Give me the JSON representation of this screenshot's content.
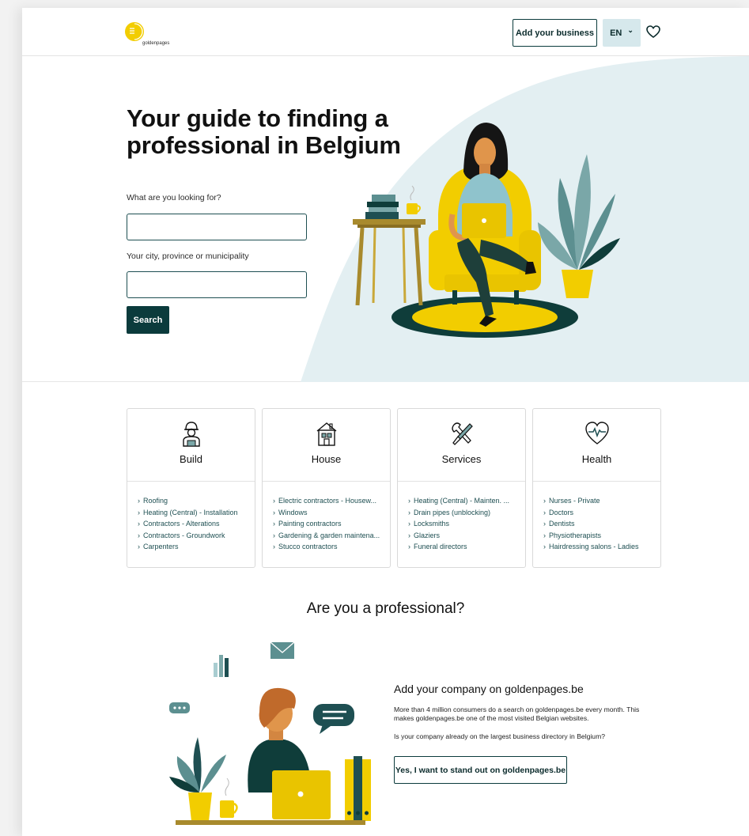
{
  "header": {
    "logo_text": "goldenpages",
    "add_business_label": "Add your business",
    "lang_label": "EN",
    "lang_chevron": "⌄"
  },
  "hero": {
    "title": "Your guide to finding a professional in Belgium",
    "what_label": "What are you looking for?",
    "what_value": "",
    "where_label": "Your city, province or municipality",
    "where_value": "",
    "search_label": "Search"
  },
  "categories": [
    {
      "title": "Build",
      "icon": "worker-icon",
      "items": [
        "Roofing",
        "Heating (Central) - Installation",
        "Contractors - Alterations",
        "Contractors - Groundwork",
        "Carpenters"
      ]
    },
    {
      "title": "House",
      "icon": "house-icon",
      "items": [
        "Electric contractors - Housew...",
        "Windows",
        "Painting contractors",
        "Gardening & garden maintena...",
        "Stucco contractors"
      ]
    },
    {
      "title": "Services",
      "icon": "tools-icon",
      "items": [
        "Heating (Central) - Mainten. ...",
        "Drain pipes (unblocking)",
        "Locksmiths",
        "Glaziers",
        "Funeral directors"
      ]
    },
    {
      "title": "Health",
      "icon": "heartbeat-icon",
      "items": [
        "Nurses - Private",
        "Doctors",
        "Dentists",
        "Physiotherapists",
        "Hairdressing salons - Ladies"
      ]
    }
  ],
  "chevron": "›",
  "professional": {
    "heading": "Are you a professional?",
    "subheading": "Add your company on goldenpages.be",
    "paragraph1": "More than 4 million consumers do a search on goldenpages.be every month. This makes goldenpages.be one of the most visited Belgian websites.",
    "paragraph2": "Is your company already on the largest business directory in Belgium?",
    "cta_label": "Yes, I want to stand out on goldenpages.be"
  },
  "colors": {
    "brand_yellow": "#f2cd00",
    "dark_teal": "#0b3b3c",
    "light_blue": "#e3eff2"
  }
}
